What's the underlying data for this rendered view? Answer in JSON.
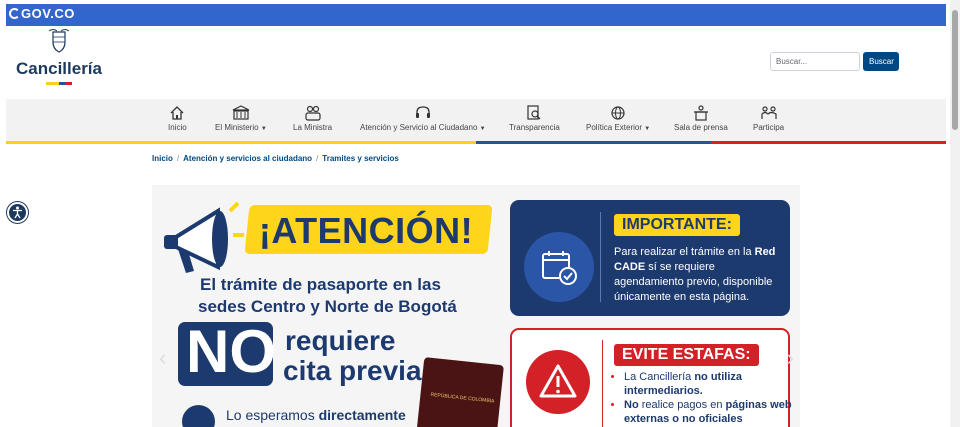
{
  "gov_bar": {
    "logo_text": "GOV.CO"
  },
  "brand": {
    "name": "Cancillería"
  },
  "search": {
    "placeholder": "Buscar...",
    "button_label": "Buscar"
  },
  "nav": {
    "items": [
      {
        "label": "Inicio",
        "icon": "home-icon",
        "dropdown": false
      },
      {
        "label": "El Ministerio",
        "icon": "building-icon",
        "dropdown": true
      },
      {
        "label": "La Ministra",
        "icon": "people-icon",
        "dropdown": false
      },
      {
        "label": "Atención y Servicio al Ciudadano",
        "icon": "headset-icon",
        "dropdown": true
      },
      {
        "label": "Transparencia",
        "icon": "document-search-icon",
        "dropdown": false
      },
      {
        "label": "Política Exterior",
        "icon": "globe-icon",
        "dropdown": true
      },
      {
        "label": "Sala de prensa",
        "icon": "podium-icon",
        "dropdown": false
      },
      {
        "label": "Participa",
        "icon": "participate-icon",
        "dropdown": false
      }
    ]
  },
  "breadcrumb": {
    "items": [
      "Inicio",
      "Atención y servicios al ciudadano",
      "Tramites y servicios"
    ]
  },
  "banner": {
    "headline": "¡ATENCIÓN!",
    "line1": "El trámite de pasaporte en las",
    "line2": "sedes Centro y Norte de Bogotá",
    "no": "NO",
    "req1": "requiere",
    "req2": "cita previa.",
    "esperamos_prefix": "Lo esperamos ",
    "esperamos_bold": "directamente",
    "passport_text": "REPÚBLICA DE COLOMBIA",
    "importante": {
      "tag": "IMPORTANTE:",
      "text1": "Para realizar el trámite en la ",
      "bold": "Red CADE",
      "text2": " sí se requiere agendamiento previo, disponible únicamente en esta página."
    },
    "estafas": {
      "tag": "EVITE ESTAFAS:",
      "b1_prefix": "La Cancillería ",
      "b1_bold": "no utiliza intermediarios.",
      "b2_bold1": "No",
      "b2_text": " realice pagos en ",
      "b2_bold2": "páginas web externas o no oficiales"
    }
  },
  "colors": {
    "gov_blue": "#3366cc",
    "navy": "#1d3a6e",
    "yellow": "#ffd51c",
    "red": "#d42027",
    "button_blue": "#004884"
  }
}
